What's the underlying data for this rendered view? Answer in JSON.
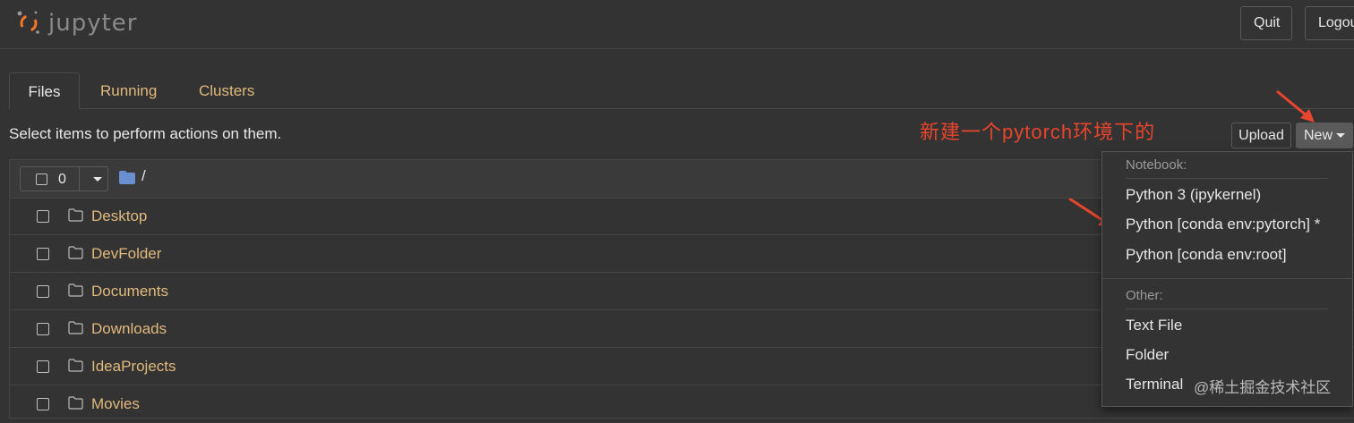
{
  "header": {
    "brand": "jupyter",
    "quit_label": "Quit",
    "logout_label": "Logout"
  },
  "tabs": [
    {
      "label": "Files",
      "active": true
    },
    {
      "label": "Running",
      "active": false
    },
    {
      "label": "Clusters",
      "active": false
    }
  ],
  "instructions": "Select items to perform actions on them.",
  "annotation": "新建一个pytorch环境下的",
  "toolbar": {
    "upload_label": "Upload",
    "new_label": "New"
  },
  "list_header": {
    "selected_count": "0",
    "breadcrumb": "/"
  },
  "files": [
    {
      "name": "Desktop",
      "icon": "folder-icon"
    },
    {
      "name": "DevFolder",
      "icon": "folder-icon"
    },
    {
      "name": "Documents",
      "icon": "folder-icon"
    },
    {
      "name": "Downloads",
      "icon": "folder-icon"
    },
    {
      "name": "IdeaProjects",
      "icon": "folder-icon"
    },
    {
      "name": "Movies",
      "icon": "folder-icon"
    }
  ],
  "new_menu": {
    "notebook_header": "Notebook:",
    "notebook_items": [
      "Python 3 (ipykernel)",
      "Python [conda env:pytorch] *",
      "Python [conda env:root]"
    ],
    "other_header": "Other:",
    "other_items": [
      "Text File",
      "Folder",
      "Terminal"
    ]
  },
  "watermark": "@稀土掘金技术社区",
  "colors": {
    "background": "#333333",
    "link": "#e0b97c",
    "annotation": "#e8452c",
    "logo_orange": "#f37726"
  }
}
